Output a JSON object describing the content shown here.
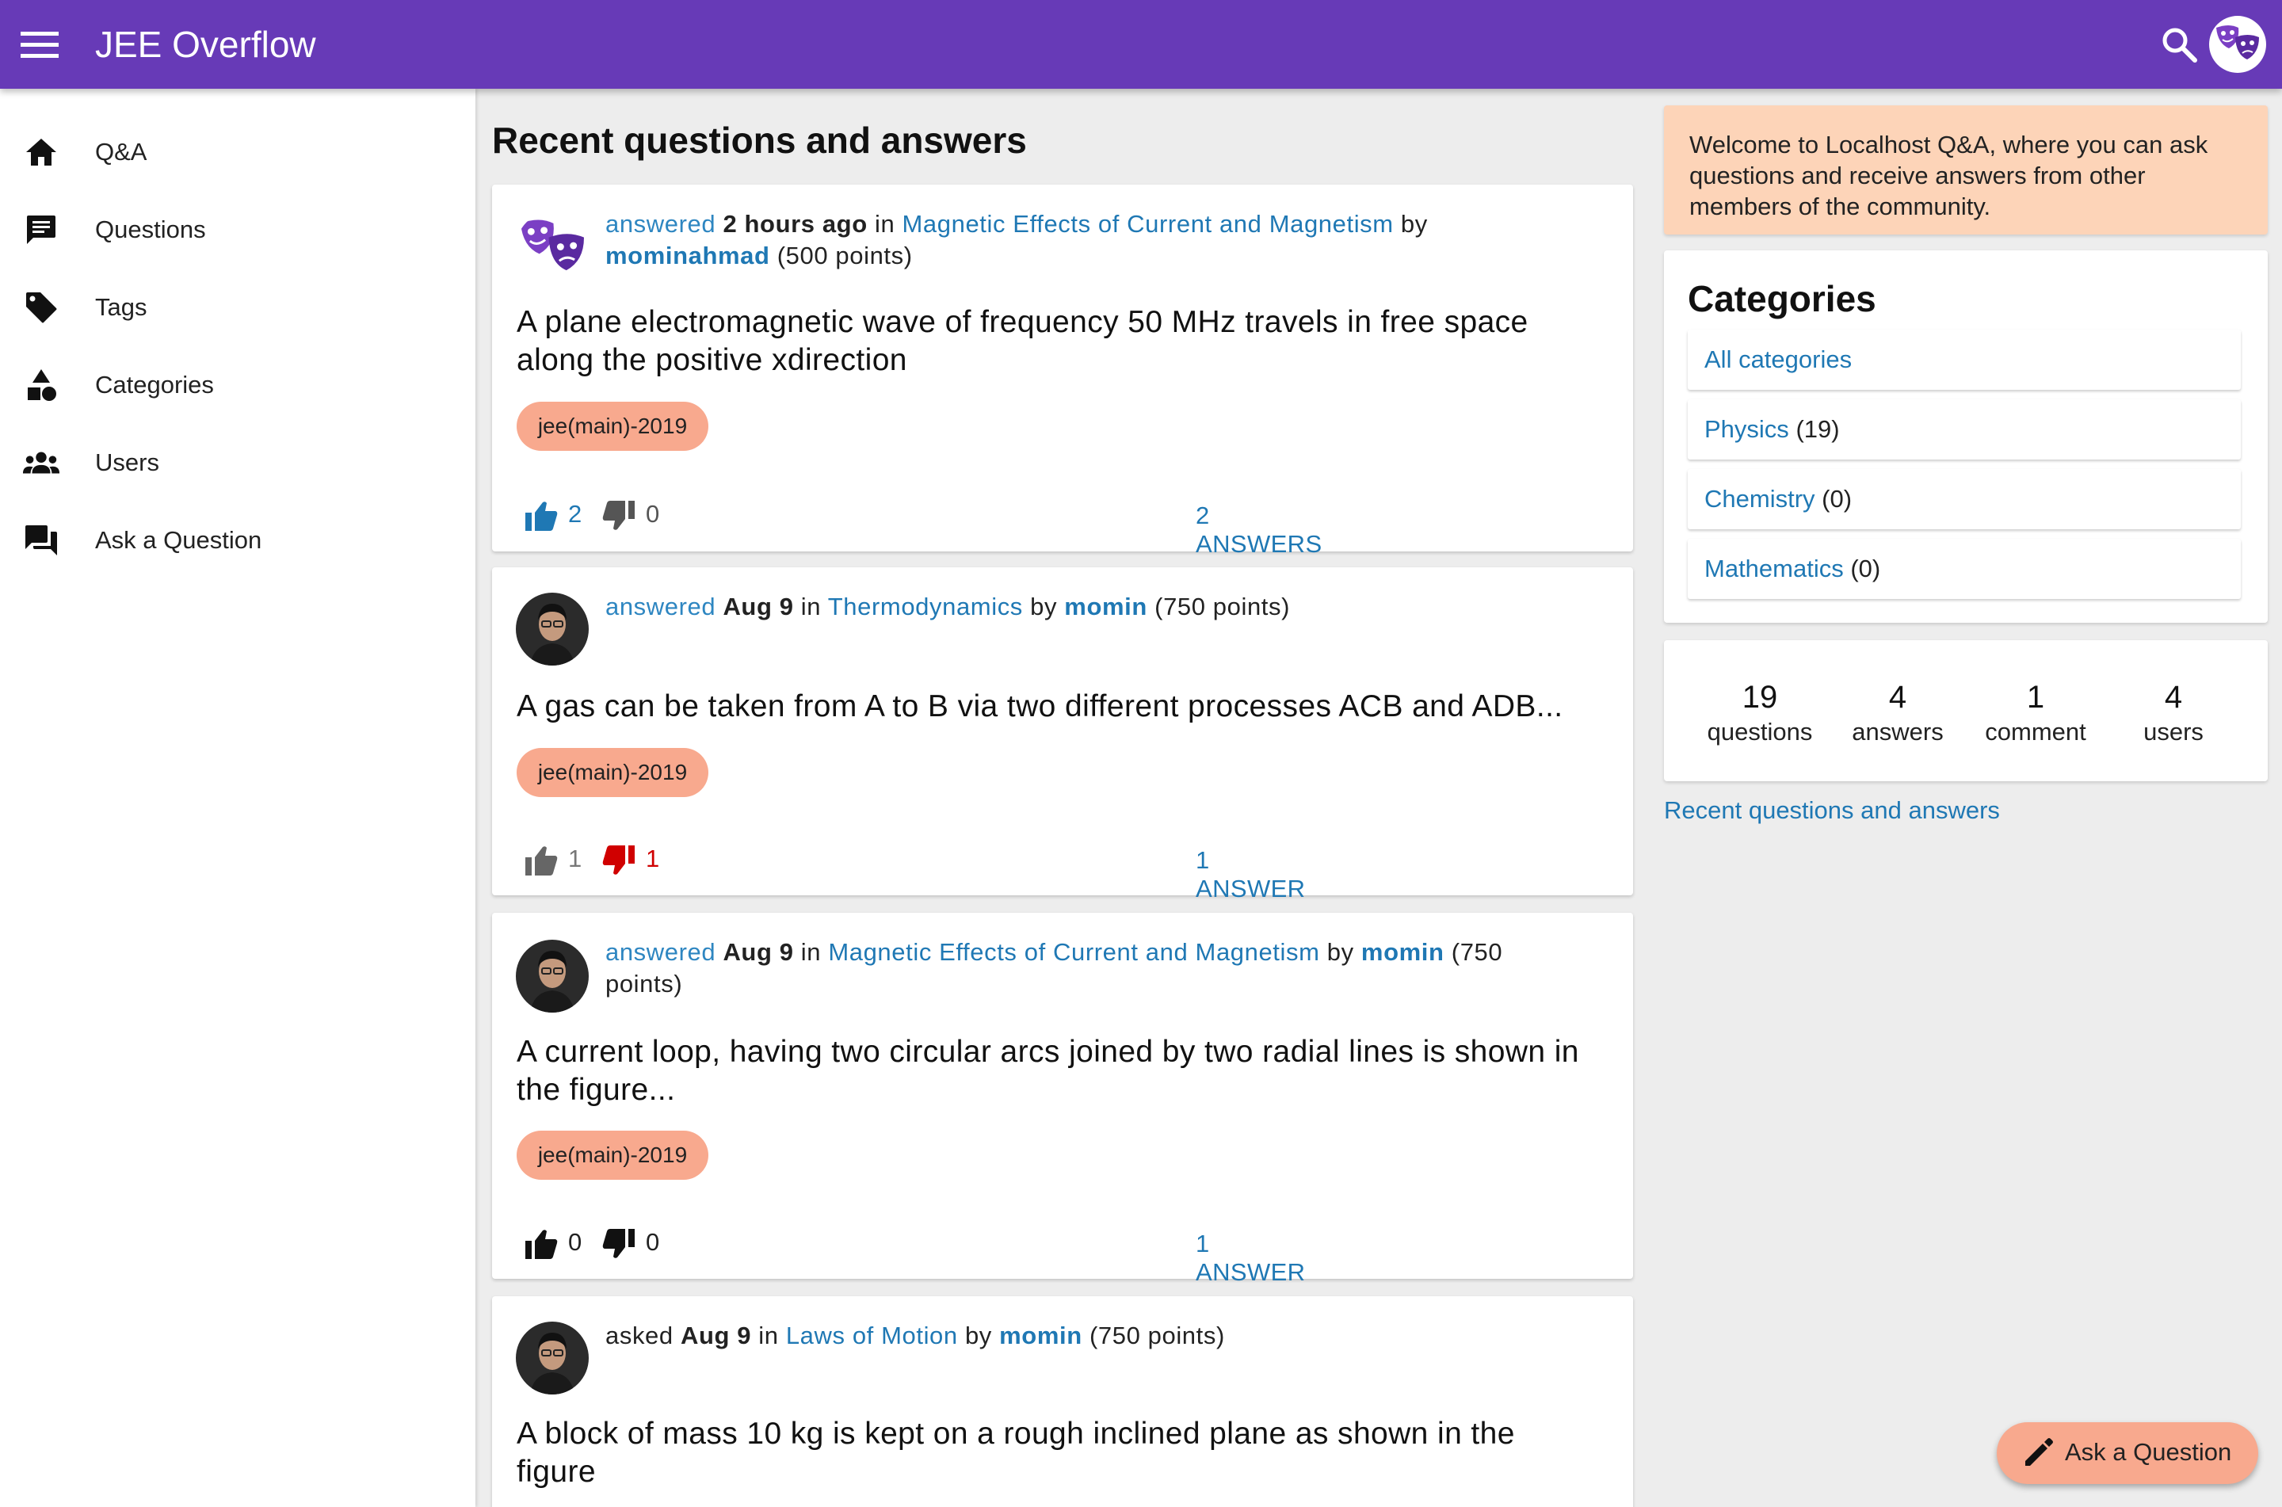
{
  "appbar": {
    "title": "JEE Overflow",
    "menu_icon": "menu-icon",
    "search_icon": "search-icon",
    "avatar_icon": "theater-masks-icon"
  },
  "sidebar": {
    "items": [
      {
        "label": "Q&A",
        "icon": "home-icon"
      },
      {
        "label": "Questions",
        "icon": "message-icon"
      },
      {
        "label": "Tags",
        "icon": "tag-icon"
      },
      {
        "label": "Categories",
        "icon": "shapes-icon"
      },
      {
        "label": "Users",
        "icon": "people-icon"
      },
      {
        "label": "Ask a Question",
        "icon": "forum-icon"
      }
    ]
  },
  "main": {
    "title": "Recent questions and answers",
    "questions": [
      {
        "action": "answered",
        "when": "2 hours ago",
        "in_word": "in",
        "category": "Magnetic Effects of Current and Magnetism",
        "by_word": "by",
        "user": "mominahmad",
        "points": "(500 points)",
        "title": "A plane electromagnetic wave of frequency 50 MHz travels in free space along the positive xdirection",
        "tag": "jee(main)-2019",
        "upvotes": "2",
        "downvotes": "0",
        "answers": "2 ANSWERS"
      },
      {
        "action": "answered",
        "when": "Aug 9",
        "in_word": "in",
        "category": "Thermodynamics",
        "by_word": "by",
        "user": "momin",
        "points": "(750 points)",
        "title": "A gas can be taken from A to B via two different processes ACB and ADB...",
        "tag": "jee(main)-2019",
        "upvotes": "1",
        "downvotes": "1",
        "answers": "1 ANSWER"
      },
      {
        "action": "answered",
        "when": "Aug 9",
        "in_word": "in",
        "category": "Magnetic Effects of Current and Magnetism",
        "by_word": "by",
        "user": "momin",
        "points": "(750 points)",
        "title": "A current loop, having two circular arcs joined by two radial lines is shown in the figure...",
        "tag": "jee(main)-2019",
        "upvotes": "0",
        "downvotes": "0",
        "answers": "1 ANSWER"
      },
      {
        "action": "asked",
        "when": "Aug 9",
        "in_word": "in",
        "category": "Laws of Motion",
        "by_word": "by",
        "user": "momin",
        "points": "(750 points)",
        "title": "A block of mass 10 kg is kept on a rough inclined plane as shown in the figure"
      }
    ]
  },
  "welcome": {
    "text": "Welcome to Localhost Q&A, where you can ask questions and receive answers from other members of the community."
  },
  "categories": {
    "title": "Categories",
    "items": [
      {
        "name": "All categories",
        "count": ""
      },
      {
        "name": "Physics",
        "count": "(19)"
      },
      {
        "name": "Chemistry",
        "count": "(0)"
      },
      {
        "name": "Mathematics",
        "count": "(0)"
      }
    ]
  },
  "stats": [
    {
      "num": "19",
      "label": "questions"
    },
    {
      "num": "4",
      "label": "answers"
    },
    {
      "num": "1",
      "label": "comment"
    },
    {
      "num": "4",
      "label": "users"
    }
  ],
  "recent_link": "Recent questions and answers",
  "fab": {
    "label": "Ask a Question",
    "icon": "pencil-icon"
  },
  "colors": {
    "appbar": "#673ab7",
    "link": "#1f78b4",
    "tag": "#f8a98e",
    "welcome": "#fdd4b8",
    "upvote_active": "#1f78b4",
    "downvote_active": "#d00000"
  }
}
